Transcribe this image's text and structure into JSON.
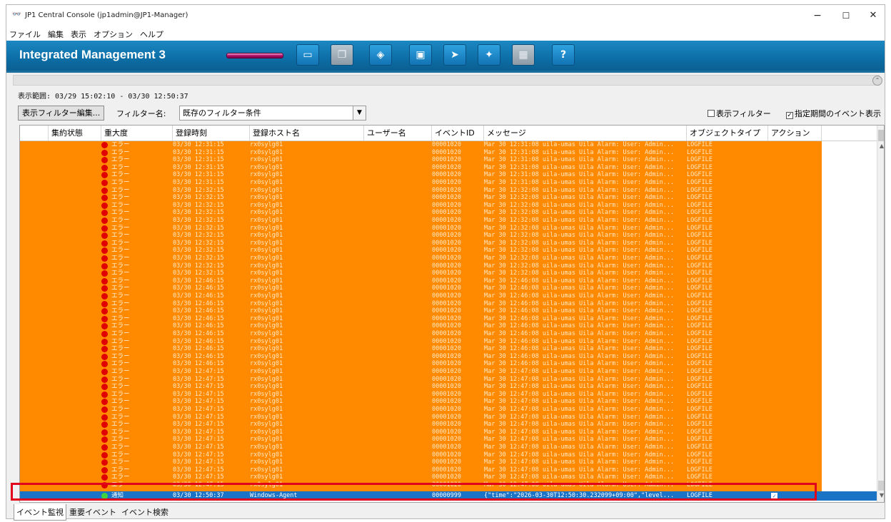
{
  "window": {
    "title": "JP1 Central Console (jp1admin@JP1-Manager)",
    "minimize": "−",
    "maximize": "☐",
    "close": "✕"
  },
  "menu": [
    "ファイル",
    "編集",
    "表示",
    "オプション",
    "ヘルプ"
  ],
  "banner": {
    "brand": "Integrated Management 3",
    "toolbar_icons": [
      "monitor-icon",
      "stack-icon",
      "diamond-icon",
      "window-icon",
      "arrow-cursor-icon",
      "puzzle-icon",
      "grid-icon",
      "help-icon"
    ],
    "help_label": "?"
  },
  "range_text": "表示範囲: 03/29 15:02:10 - 03/30 12:50:37",
  "filter": {
    "edit_button": "表示フィルター編集...",
    "name_label": "フィルター名:",
    "selected": "既存のフィルター条件",
    "display_filter_label": "表示フィルター",
    "display_filter_checked": false,
    "period_label": "指定期間のイベント表示",
    "period_checked": true
  },
  "columns": [
    "集約状態",
    "重大度",
    "登録時刻",
    "登録ホスト名",
    "ユーザー名",
    "イベントID",
    "メッセージ",
    "オブジェクトタイプ",
    "アクション"
  ],
  "events": {
    "severity": "エラー",
    "host": "rx0sylg01",
    "event_id": "00001020",
    "object_type": "LOGFILE",
    "rows": [
      {
        "time": "03/30 12:31:15",
        "msg": "Mar 30 12:31:08 uila-umas Uila Alarm: User: Admin..."
      },
      {
        "time": "03/30 12:31:15",
        "msg": "Mar 30 12:31:08 uila-umas Uila Alarm: User: Admin..."
      },
      {
        "time": "03/30 12:31:15",
        "msg": "Mar 30 12:31:08 uila-umas Uila Alarm: User: Admin..."
      },
      {
        "time": "03/30 12:31:15",
        "msg": "Mar 30 12:31:08 uila-umas Uila Alarm: User: Admin..."
      },
      {
        "time": "03/30 12:31:15",
        "msg": "Mar 30 12:31:08 uila-umas Uila Alarm: User: Admin..."
      },
      {
        "time": "03/30 12:31:15",
        "msg": "Mar 30 12:31:08 uila-umas Uila Alarm: User: Admin..."
      },
      {
        "time": "03/30 12:32:15",
        "msg": "Mar 30 12:32:08 uila-umas Uila Alarm: User: Admin..."
      },
      {
        "time": "03/30 12:32:15",
        "msg": "Mar 30 12:32:08 uila-umas Uila Alarm: User: Admin..."
      },
      {
        "time": "03/30 12:32:15",
        "msg": "Mar 30 12:32:08 uila-umas Uila Alarm: User: Admin..."
      },
      {
        "time": "03/30 12:32:15",
        "msg": "Mar 30 12:32:08 uila-umas Uila Alarm: User: Admin..."
      },
      {
        "time": "03/30 12:32:15",
        "msg": "Mar 30 12:32:08 uila-umas Uila Alarm: User: Admin..."
      },
      {
        "time": "03/30 12:32:15",
        "msg": "Mar 30 12:32:08 uila-umas Uila Alarm: User: Admin..."
      },
      {
        "time": "03/30 12:32:15",
        "msg": "Mar 30 12:32:08 uila-umas Uila Alarm: User: Admin..."
      },
      {
        "time": "03/30 12:32:15",
        "msg": "Mar 30 12:32:08 uila-umas Uila Alarm: User: Admin..."
      },
      {
        "time": "03/30 12:32:15",
        "msg": "Mar 30 12:32:08 uila-umas Uila Alarm: User: Admin..."
      },
      {
        "time": "03/30 12:32:15",
        "msg": "Mar 30 12:32:08 uila-umas Uila Alarm: User: Admin..."
      },
      {
        "time": "03/30 12:32:15",
        "msg": "Mar 30 12:32:08 uila-umas Uila Alarm: User: Admin..."
      },
      {
        "time": "03/30 12:32:15",
        "msg": "Mar 30 12:32:08 uila-umas Uila Alarm: User: Admin..."
      },
      {
        "time": "03/30 12:46:15",
        "msg": "Mar 30 12:46:08 uila-umas Uila Alarm: User: Admin..."
      },
      {
        "time": "03/30 12:46:15",
        "msg": "Mar 30 12:46:08 uila-umas Uila Alarm: User: Admin..."
      },
      {
        "time": "03/30 12:46:15",
        "msg": "Mar 30 12:46:08 uila-umas Uila Alarm: User: Admin..."
      },
      {
        "time": "03/30 12:46:15",
        "msg": "Mar 30 12:46:08 uila-umas Uila Alarm: User: Admin..."
      },
      {
        "time": "03/30 12:46:15",
        "msg": "Mar 30 12:46:08 uila-umas Uila Alarm: User: Admin..."
      },
      {
        "time": "03/30 12:46:15",
        "msg": "Mar 30 12:46:08 uila-umas Uila Alarm: User: Admin..."
      },
      {
        "time": "03/30 12:46:15",
        "msg": "Mar 30 12:46:08 uila-umas Uila Alarm: User: Admin..."
      },
      {
        "time": "03/30 12:46:15",
        "msg": "Mar 30 12:46:08 uila-umas Uila Alarm: User: Admin..."
      },
      {
        "time": "03/30 12:46:15",
        "msg": "Mar 30 12:46:08 uila-umas Uila Alarm: User: Admin..."
      },
      {
        "time": "03/30 12:46:15",
        "msg": "Mar 30 12:46:08 uila-umas Uila Alarm: User: Admin..."
      },
      {
        "time": "03/30 12:46:15",
        "msg": "Mar 30 12:46:08 uila-umas Uila Alarm: User: Admin..."
      },
      {
        "time": "03/30 12:46:15",
        "msg": "Mar 30 12:46:08 uila-umas Uila Alarm: User: Admin..."
      },
      {
        "time": "03/30 12:47:15",
        "msg": "Mar 30 12:47:08 uila-umas Uila Alarm: User: Admin..."
      },
      {
        "time": "03/30 12:47:15",
        "msg": "Mar 30 12:47:08 uila-umas Uila Alarm: User: Admin..."
      },
      {
        "time": "03/30 12:47:15",
        "msg": "Mar 30 12:47:08 uila-umas Uila Alarm: User: Admin..."
      },
      {
        "time": "03/30 12:47:15",
        "msg": "Mar 30 12:47:08 uila-umas Uila Alarm: User: Admin..."
      },
      {
        "time": "03/30 12:47:15",
        "msg": "Mar 30 12:47:08 uila-umas Uila Alarm: User: Admin..."
      },
      {
        "time": "03/30 12:47:15",
        "msg": "Mar 30 12:47:08 uila-umas Uila Alarm: User: Admin..."
      },
      {
        "time": "03/30 12:47:15",
        "msg": "Mar 30 12:47:08 uila-umas Uila Alarm: User: Admin..."
      },
      {
        "time": "03/30 12:47:15",
        "msg": "Mar 30 12:47:08 uila-umas Uila Alarm: User: Admin..."
      },
      {
        "time": "03/30 12:47:15",
        "msg": "Mar 30 12:47:08 uila-umas Uila Alarm: User: Admin..."
      },
      {
        "time": "03/30 12:47:15",
        "msg": "Mar 30 12:47:08 uila-umas Uila Alarm: User: Admin..."
      },
      {
        "time": "03/30 12:47:15",
        "msg": "Mar 30 12:47:08 uila-umas Uila Alarm: User: Admin..."
      },
      {
        "time": "03/30 12:47:15",
        "msg": "Mar 30 12:47:08 uila-umas Uila Alarm: User: Admin..."
      },
      {
        "time": "03/30 12:47:15",
        "msg": "Mar 30 12:47:08 uila-umas Uila Alarm: User: Admin..."
      },
      {
        "time": "03/30 12:47:15",
        "msg": "Mar 30 12:47:08 uila-umas Uila Alarm: User: Admin..."
      },
      {
        "time": "03/30 12:47:15",
        "msg": "Mar 30 12:47:08 uila-umas Uila Alarm: User: Admin..."
      },
      {
        "time": "03/30 12:47:15",
        "msg": "Mar 30 12:47:08 uila-umas Uila Alarm: User: Admin..."
      }
    ]
  },
  "selected_event": {
    "severity": "通知",
    "time": "03/30 12:50:37",
    "host": "Windows-Agent",
    "event_id": "00000999",
    "msg": "{\"time\":\"2026-03-30T12:50:30.232099+09:00\",\"level...",
    "object_type": "LOGFILE",
    "action_checked": true
  },
  "tabs": [
    "イベント監視",
    "重要イベント",
    "イベント検索"
  ],
  "colors": {
    "error_row": "#ff8a00",
    "selected_row": "#1a73c4",
    "banner": "#0d6ea6",
    "highlight_border": "#e0001b"
  }
}
